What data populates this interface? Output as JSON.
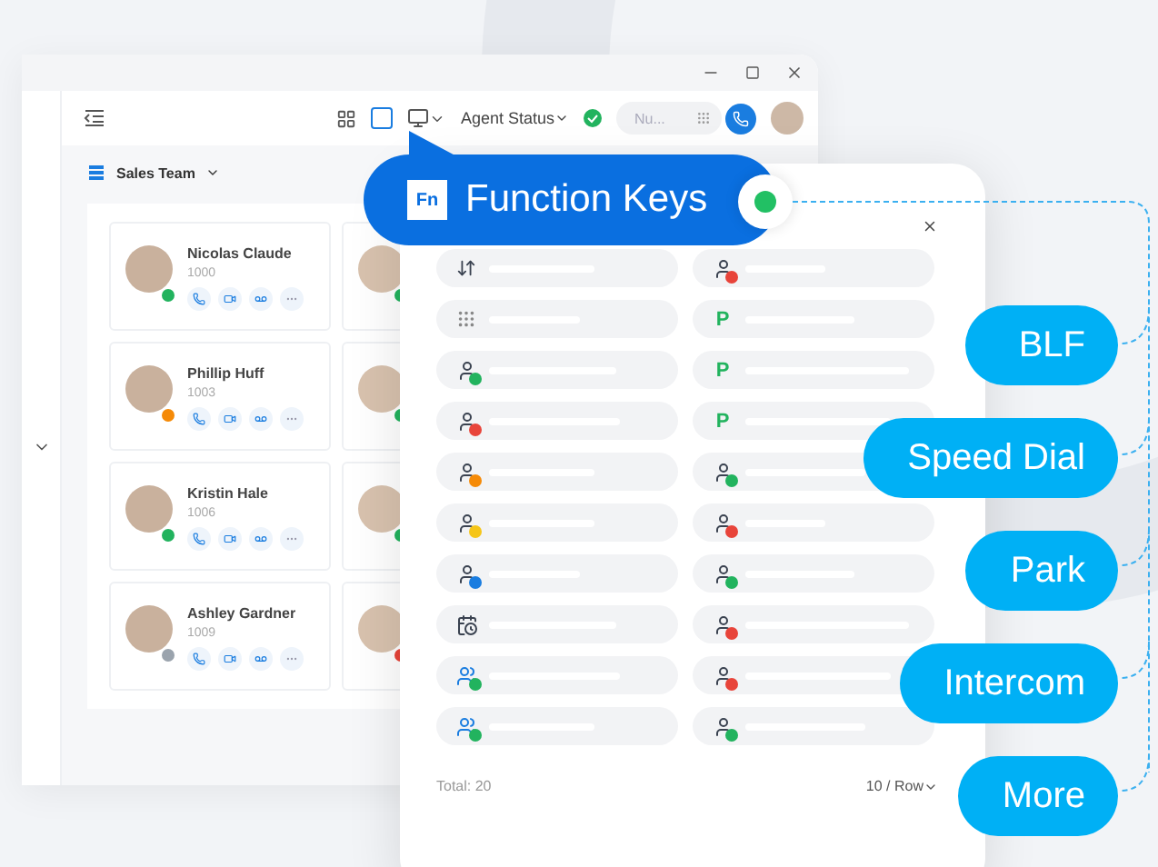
{
  "toolbar": {
    "agent_status": "Agent Status",
    "search": {
      "placeholder": "Nu..."
    }
  },
  "team": {
    "title": "Sales Team"
  },
  "contacts": [
    {
      "name": "Nicolas Claude",
      "ext": "1000",
      "color": "#22b35e"
    },
    {
      "color": "#22b35e"
    },
    {
      "name": "Phillip Huff",
      "ext": "1003",
      "color": "#f58a07"
    },
    {
      "color": "#22b35e"
    },
    {
      "name": "Kristin Hale",
      "ext": "1006",
      "color": "#22b35e"
    },
    {
      "color": "#22b35e"
    },
    {
      "name": "Ashley Gardner",
      "ext": "1009",
      "color": "#9aa3ad"
    },
    {
      "color": "#e8443a"
    }
  ],
  "callout": {
    "badge": "Fn",
    "title": "Function Keys"
  },
  "panel": {
    "keys": [
      {
        "kind": "transfer"
      },
      {
        "kind": "contact",
        "color": "#e8443a"
      },
      {
        "kind": "dialpad"
      },
      {
        "kind": "park",
        "label": "P"
      },
      {
        "kind": "contact",
        "color": "#22b35e"
      },
      {
        "kind": "park",
        "label": "P"
      },
      {
        "kind": "contact",
        "color": "#e8443a"
      },
      {
        "kind": "park",
        "label": "P"
      },
      {
        "kind": "contact",
        "color": "#f58a07"
      },
      {
        "kind": "contact",
        "color": "#22b35e"
      },
      {
        "kind": "contact",
        "color": "#f5c518"
      },
      {
        "kind": "contact",
        "color": "#e8443a"
      },
      {
        "kind": "contact",
        "color": "#1a7de0"
      },
      {
        "kind": "contact",
        "color": "#22b35e"
      },
      {
        "kind": "calendar"
      },
      {
        "kind": "contact",
        "color": "#e8443a"
      },
      {
        "kind": "group",
        "color": "#22b35e"
      },
      {
        "kind": "contact",
        "color": "#e8443a"
      },
      {
        "kind": "group",
        "color": "#22b35e"
      },
      {
        "kind": "contact",
        "color": "#22b35e"
      }
    ],
    "total": "Total: 20",
    "page_size": "10 / Row"
  },
  "labels": [
    "BLF",
    "Speed Dial",
    "Park",
    "Intercom",
    "More"
  ]
}
